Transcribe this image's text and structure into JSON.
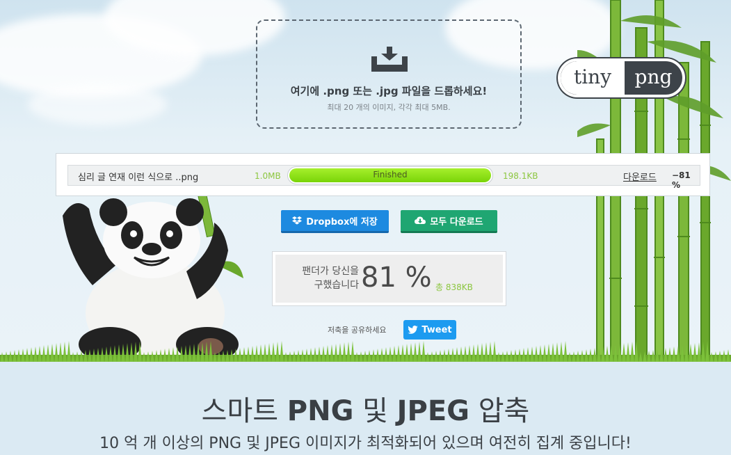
{
  "dropzone": {
    "title": "여기에 .png 또는 .jpg 파일을 드롭하세요!",
    "subtitle": "최대 20 개의 이미지, 각각 최대 5MB.",
    "icon": "download-tray-icon"
  },
  "logo": {
    "left": "tiny",
    "right": "png"
  },
  "result": {
    "filename": "심리 글 연재 이런 식으로 ..png",
    "original_size": "1.0MB",
    "progress_label": "Finished",
    "progress": 1.0,
    "new_size": "198.1KB",
    "download_label": "다운로드",
    "savings": "−81 %"
  },
  "buttons": {
    "dropbox_label": "Dropbox에 저장",
    "download_all_label": "모두 다운로드"
  },
  "summary": {
    "text_line1": "팬더가 당신을",
    "text_line2": "구했습니다",
    "percent": "81 %",
    "total": "총 838KB"
  },
  "share": {
    "label": "저축을 공유하세요",
    "tweet_label": "Tweet"
  },
  "bottom": {
    "headline_pre": "스마트 ",
    "headline_png": "PNG",
    "headline_mid": " 및 ",
    "headline_jpeg": "JPEG",
    "headline_post": " 압축",
    "subline": "10 억 개 이상의 PNG 및 JPEG 이미지가 최적화되어 있으며 여전히 집계 중입니다!"
  },
  "colors": {
    "accent_green": "#8cc63f",
    "dropbox_blue": "#1d8ae0",
    "download_green": "#1fa672",
    "twitter_blue": "#1d9bf0"
  }
}
